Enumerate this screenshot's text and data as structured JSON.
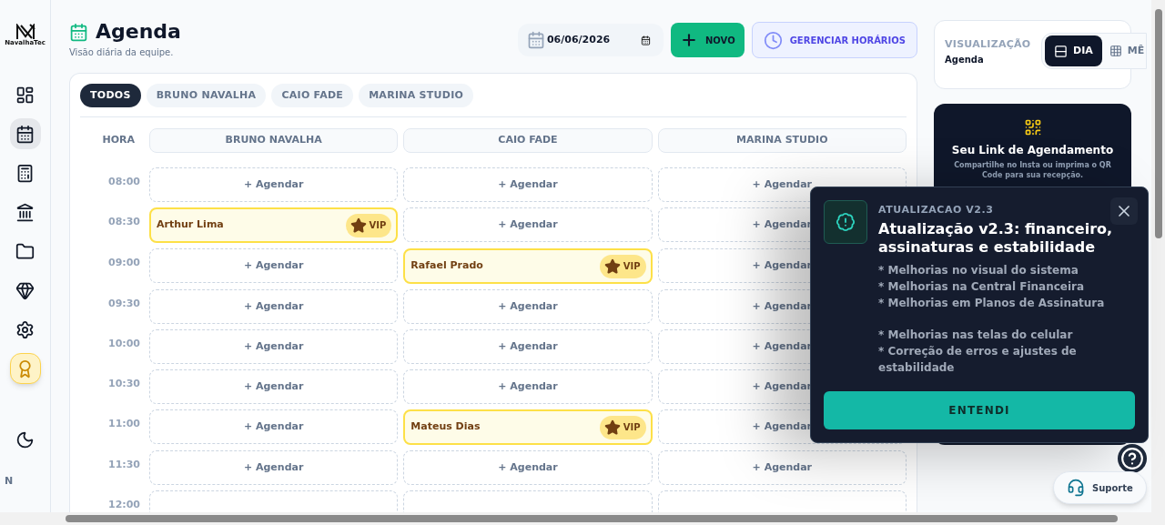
{
  "sidebar": {
    "logo_text": "NavalhaTec",
    "items": [
      {
        "kind": "nav",
        "selected": false
      },
      {
        "kind": "nav",
        "selected": true
      },
      {
        "kind": "nav",
        "selected": false
      },
      {
        "kind": "nav",
        "selected": false
      },
      {
        "kind": "nav",
        "selected": false
      },
      {
        "kind": "nav",
        "selected": false
      },
      {
        "kind": "nav",
        "selected": false
      },
      {
        "kind": "highlight",
        "selected": false
      }
    ],
    "user_initial": "N"
  },
  "header": {
    "title": "Agenda",
    "subtitle": "Visão diária da equipe.",
    "date": "06/06/2026",
    "new_button": "NOVO",
    "hours_button": "GERENCIAR HORÁRIOS"
  },
  "filters": [
    {
      "label": "TODOS",
      "selected": true
    },
    {
      "label": "BRUNO NAVALHA",
      "selected": false
    },
    {
      "label": "CAIO FADE",
      "selected": false
    },
    {
      "label": "MARINA STUDIO",
      "selected": false
    }
  ],
  "schedule": {
    "time_header": "HORA",
    "columns": [
      "BRUNO NAVALHA",
      "CAIO FADE",
      "MARINA STUDIO"
    ],
    "rows": [
      {
        "time": "08:00",
        "cells": [
          {
            "kind": "slot",
            "label": "+ Agendar"
          },
          {
            "kind": "slot",
            "label": "+ Agendar"
          },
          {
            "kind": "slot",
            "label": "+ Agendar"
          }
        ]
      },
      {
        "time": "08:30",
        "cells": [
          {
            "kind": "booking",
            "client": "Arthur Lima",
            "badge": "VIP"
          },
          {
            "kind": "slot",
            "label": "+ Agendar"
          },
          {
            "kind": "slot",
            "label": "+ Agendar"
          }
        ]
      },
      {
        "time": "09:00",
        "cells": [
          {
            "kind": "slot",
            "label": "+ Agendar"
          },
          {
            "kind": "booking",
            "client": "Rafael Prado",
            "badge": "VIP"
          },
          {
            "kind": "slot",
            "label": "+ Agendar"
          }
        ]
      },
      {
        "time": "09:30",
        "cells": [
          {
            "kind": "slot",
            "label": "+ Agendar"
          },
          {
            "kind": "slot",
            "label": "+ Agendar"
          },
          {
            "kind": "slot",
            "label": "+ Agendar"
          }
        ]
      },
      {
        "time": "10:00",
        "cells": [
          {
            "kind": "slot",
            "label": "+ Agendar"
          },
          {
            "kind": "slot",
            "label": "+ Agendar"
          },
          {
            "kind": "slot",
            "label": "+ Agendar"
          }
        ]
      },
      {
        "time": "10:30",
        "cells": [
          {
            "kind": "slot",
            "label": "+ Agendar"
          },
          {
            "kind": "slot",
            "label": "+ Agendar"
          },
          {
            "kind": "slot",
            "label": "+ Agendar"
          }
        ]
      },
      {
        "time": "11:00",
        "cells": [
          {
            "kind": "slot",
            "label": "+ Agendar"
          },
          {
            "kind": "booking",
            "client": "Mateus Dias",
            "badge": "VIP"
          },
          {
            "kind": "slot",
            "label": "+ Agendar"
          }
        ]
      },
      {
        "time": "11:30",
        "cells": [
          {
            "kind": "slot",
            "label": "+ Agendar"
          },
          {
            "kind": "slot",
            "label": "+ Agendar"
          },
          {
            "kind": "slot",
            "label": "+ Agendar"
          }
        ]
      },
      {
        "time": "12:00",
        "cells": [
          {
            "kind": "slot"
          },
          {
            "kind": "slot"
          },
          {
            "kind": "slot"
          }
        ]
      }
    ]
  },
  "view_card": {
    "label": "VISUALIZAÇÃO",
    "value": "Agenda",
    "options": [
      {
        "label": "DIA",
        "selected": true
      },
      {
        "label": "MÊ",
        "selected": false
      }
    ]
  },
  "link_card": {
    "title": "Seu Link de Agendamento",
    "description": "Compartilhe no Insta ou imprima o QR Code para sua recepção."
  },
  "update_modal": {
    "eyebrow": "ATUALIZACAO V2.3",
    "title": "Atualização v2.3: financeiro, assinaturas e estabilidade",
    "note_groups": [
      {
        "lines": [
          "* Melhorias no visual do sistema",
          "* Melhorias na Central Financeira",
          "* Melhorias em Planos de Assinatura"
        ]
      },
      {
        "lines": [
          "* Melhorias nas telas do celular",
          "* Correção de erros e ajustes de estabilidade"
        ]
      }
    ],
    "button": "ENTENDI"
  },
  "support": {
    "label": "Suporte"
  }
}
